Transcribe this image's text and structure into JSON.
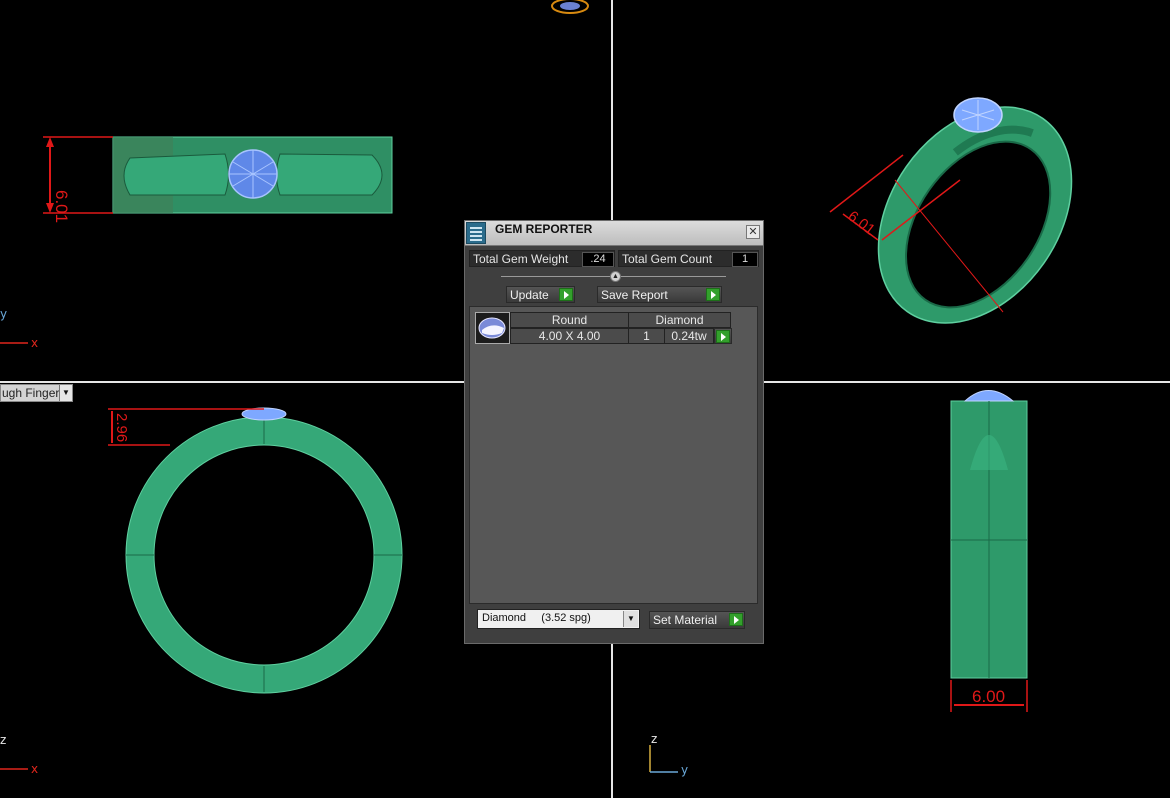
{
  "viewports": {
    "top_view": {
      "dimension": "6.01",
      "axis_y": "y",
      "axis_x": "x"
    },
    "perspective_view": {
      "dimension": "6.01"
    },
    "front_view": {
      "dimension": "2.96",
      "axis_z": "z",
      "axis_x": "x",
      "view_selector": "ugh Finger"
    },
    "side_view": {
      "dimension": "6.00",
      "axis_z": "z",
      "axis_y": "y"
    }
  },
  "gem_reporter": {
    "title": "GEM REPORTER",
    "total_weight_label": "Total Gem Weight",
    "total_weight_value": ".24",
    "total_count_label": "Total Gem Count",
    "total_count_value": "1",
    "update_label": "Update",
    "save_report_label": "Save Report",
    "gems": [
      {
        "shape": "Round",
        "size": "4.00 X 4.00",
        "material": "Diamond",
        "count": "1",
        "weight": "0.24tw"
      }
    ],
    "material_select": "Diamond     (3.52 spg)",
    "set_material_label": "Set Material"
  },
  "colors": {
    "ring_green": "#2f9a6e",
    "gem_blue": "#7ea8ff",
    "dimension_red": "#e01818",
    "axis_orange": "#e0261c",
    "axis_blue": "#6aa8d8"
  }
}
